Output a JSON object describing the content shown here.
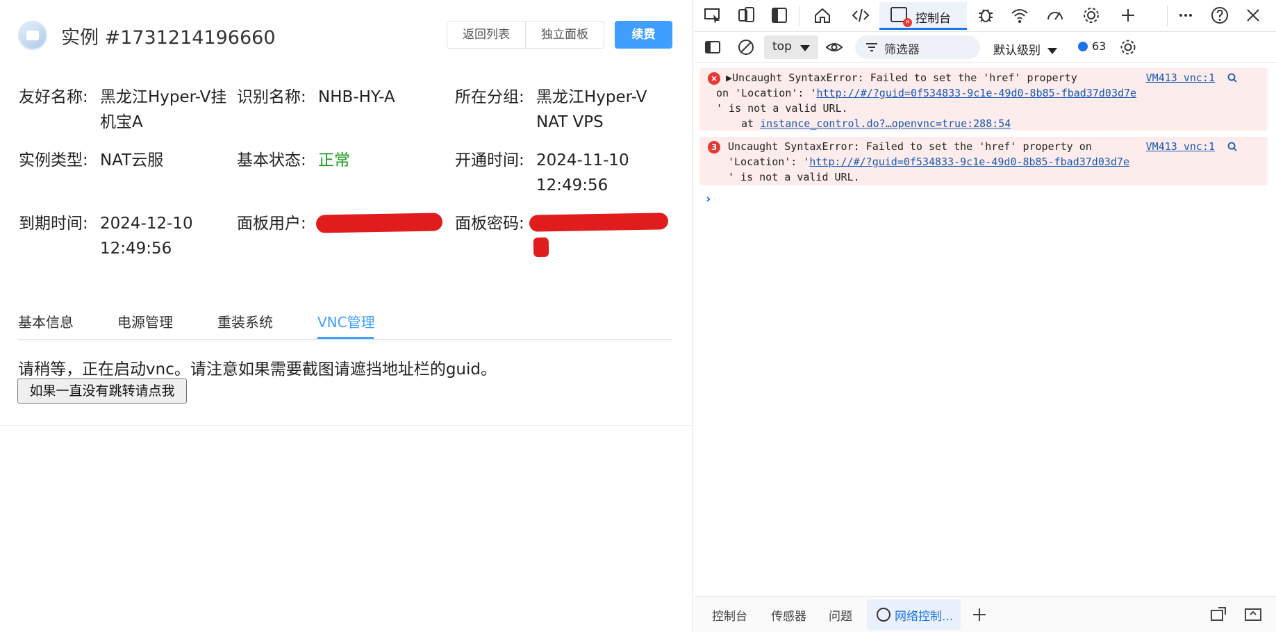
{
  "app": {
    "title": "实例 #1731214196660",
    "buttons": {
      "back": "返回列表",
      "panel": "独立面板",
      "renew": "续费"
    }
  },
  "info": {
    "friendly_name": {
      "label": "友好名称:",
      "value": "黑龙江Hyper-V挂机宝A"
    },
    "ident_name": {
      "label": "识别名称:",
      "value": "NHB-HY-A"
    },
    "group": {
      "label": "所在分组:",
      "value": "黑龙江Hyper-V NAT VPS"
    },
    "type": {
      "label": "实例类型:",
      "value": "NAT云服"
    },
    "status": {
      "label": "基本状态:",
      "value": "正常",
      "color": "#1a9a1a"
    },
    "open_time": {
      "label": "开通时间:",
      "value": "2024-11-10 12:49:56"
    },
    "expire_time": {
      "label": "到期时间:",
      "value": "2024-12-10 12:49:56"
    },
    "panel_user": {
      "label": "面板用户:",
      "value": "redacted"
    },
    "panel_pass": {
      "label": "面板密码:",
      "value": "redacted"
    }
  },
  "tabs": [
    "基本信息",
    "电源管理",
    "重装系统",
    "VNC管理"
  ],
  "active_tab": "VNC管理",
  "vnc": {
    "message": "请稍等，正在启动vnc。请注意如果需要截图请遮挡地址栏的guid。",
    "button": "如果一直没有跳转请点我"
  },
  "devtools": {
    "main_tab": "控制台",
    "context": "top",
    "filter_placeholder": "筛选器",
    "levels": "默认级别",
    "message_count": "63",
    "errors": [
      {
        "count": "",
        "line1": "Uncaught SyntaxError: Failed to set the 'href' property",
        "line2_prefix": "on 'Location': '",
        "url": "http://#/?guid=0f534833-9c1e-49d0-8b85-fbad37d03d7e",
        "line3": "' is not a valid URL.",
        "stack_prefix": "at ",
        "stack_link": "instance_control.do?…openvnc=true:288:54",
        "source": "VM413 vnc:1"
      },
      {
        "count": "3",
        "line1": "Uncaught SyntaxError: Failed to set the 'href' property on",
        "line2_prefix": "'Location': '",
        "url": "http://#/?guid=0f534833-9c1e-49d0-8b85-fbad37d03d7e",
        "line3": "' is not a valid URL.",
        "source": "VM413 vnc:1"
      }
    ],
    "drawer_tabs": [
      "控制台",
      "传感器",
      "问题",
      "网络控制..."
    ],
    "drawer_active": "网络控制..."
  }
}
